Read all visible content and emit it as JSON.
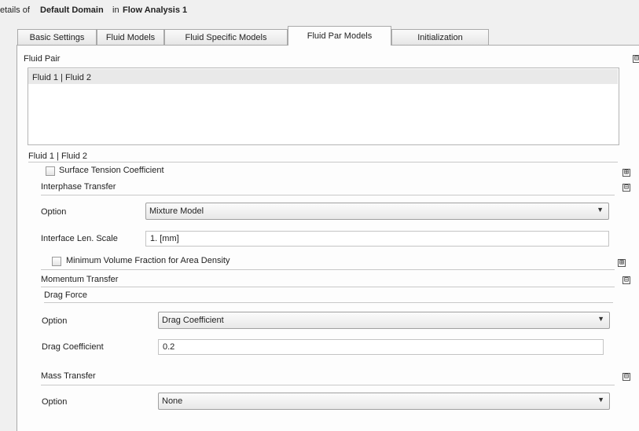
{
  "header": {
    "prefix": "etails of",
    "object": "Default Domain",
    "connector": "in",
    "analysis": "Flow Analysis 1"
  },
  "tabs": [
    {
      "label": "Basic Settings",
      "active": false
    },
    {
      "label": "Fluid Models",
      "active": false
    },
    {
      "label": "Fluid Specific Models",
      "active": false
    },
    {
      "label": "Fluid Par Models",
      "active": true
    },
    {
      "label": "Initialization",
      "active": false
    }
  ],
  "fluid_pair": {
    "section_label": "Fluid Pair",
    "list_items": [
      "Fluid 1 | Fluid 2"
    ],
    "selected_label": "Fluid 1 | Fluid 2"
  },
  "surface_tension": {
    "label": "Surface Tension Coefficient",
    "checked": false
  },
  "interphase": {
    "section_label": "Interphase Transfer",
    "option_label": "Option",
    "option_value": "Mixture Model",
    "scale_label": "Interface Len. Scale",
    "scale_value": "1. [mm]",
    "min_vol_label": "Minimum Volume Fraction for Area Density",
    "min_vol_checked": false
  },
  "momentum": {
    "section_label": "Momentum Transfer",
    "drag_force_label": "Drag Force",
    "option_label": "Option",
    "option_value": "Drag Coefficient",
    "coef_label": "Drag Coefficient",
    "coef_value": "0.2"
  },
  "mass": {
    "section_label": "Mass Transfer",
    "option_label": "Option",
    "option_value": "None"
  },
  "icons": {
    "collapse": "⊟",
    "expand": "⊞",
    "dropdown": "▼"
  },
  "colors": {
    "panel_bg": "#fdfdfd",
    "window_bg": "#f0f0f0",
    "selected_row": "#e9e9e9"
  }
}
